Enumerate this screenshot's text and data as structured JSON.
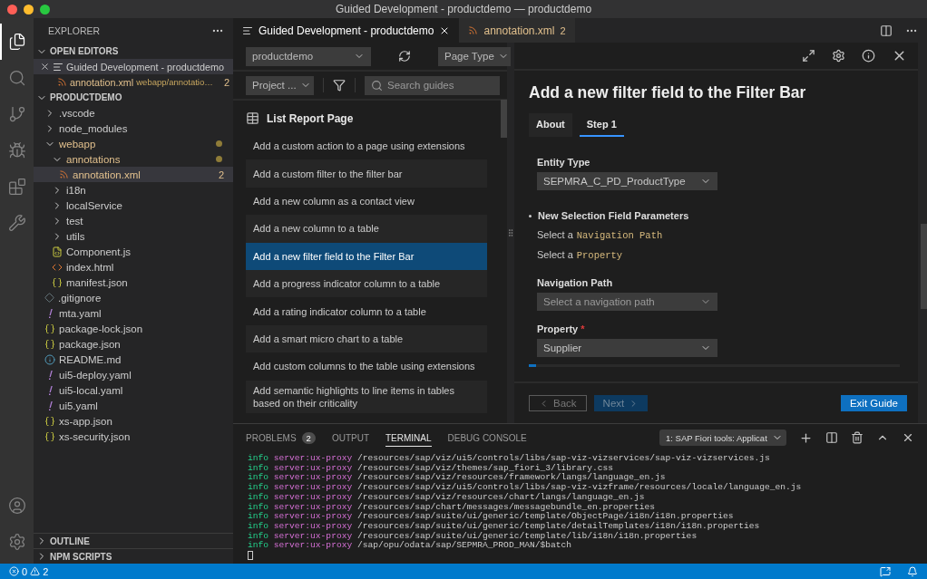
{
  "window": {
    "title": "Guided Development - productdemo — productdemo"
  },
  "activity_bar": {
    "items": [
      {
        "kind": "explorer",
        "selected": true
      },
      {
        "kind": "search",
        "selected": false
      },
      {
        "kind": "source-control",
        "selected": false
      },
      {
        "kind": "run",
        "selected": false
      },
      {
        "kind": "extensions",
        "selected": false
      },
      {
        "kind": "tools",
        "selected": false
      }
    ],
    "bottom": [
      {
        "kind": "account"
      },
      {
        "kind": "settings"
      }
    ]
  },
  "explorer": {
    "title": "EXPLORER",
    "open_editors": {
      "title": "OPEN EDITORS",
      "expanded": true,
      "items": [
        {
          "kind": "guide",
          "name": "Guided Development - productdemo",
          "selected": true
        },
        {
          "kind": "xml",
          "name": "annotation.xml",
          "description": "webapp/annotatio…",
          "badge": "2",
          "modified": true,
          "selected": false
        }
      ]
    },
    "project": {
      "title": "PRODUCTDEMO",
      "expanded": true,
      "children": [
        {
          "kind": "folder",
          "name": ".vscode",
          "expanded": false,
          "modified": false,
          "selected": false
        },
        {
          "kind": "folder",
          "name": "node_modules",
          "expanded": false,
          "modified": false,
          "selected": false
        },
        {
          "kind": "folder",
          "name": "webapp",
          "expanded": true,
          "modified": true,
          "selected": false,
          "children": [
            {
              "kind": "folder",
              "name": "annotations",
              "expanded": true,
              "modified": true,
              "selected": false,
              "children": [
                {
                  "kind": "xml",
                  "name": "annotation.xml",
                  "badge": "2",
                  "modified": true,
                  "selected": true
                }
              ]
            },
            {
              "kind": "folder",
              "name": "i18n",
              "expanded": false,
              "modified": false,
              "selected": false
            },
            {
              "kind": "folder",
              "name": "localService",
              "expanded": false,
              "modified": false,
              "selected": false
            },
            {
              "kind": "folder",
              "name": "test",
              "expanded": false,
              "modified": false,
              "selected": false
            },
            {
              "kind": "folder",
              "name": "utils",
              "expanded": false,
              "modified": false,
              "selected": false
            },
            {
              "kind": "js",
              "name": "Component.js",
              "modified": false,
              "selected": false
            },
            {
              "kind": "html",
              "name": "index.html",
              "modified": false,
              "selected": false
            },
            {
              "kind": "json",
              "name": "manifest.json",
              "modified": false,
              "selected": false
            }
          ]
        },
        {
          "kind": "git",
          "name": ".gitignore",
          "modified": false,
          "selected": false
        },
        {
          "kind": "yaml",
          "name": "mta.yaml",
          "modified": false,
          "selected": false
        },
        {
          "kind": "json",
          "name": "package-lock.json",
          "modified": false,
          "selected": false
        },
        {
          "kind": "json",
          "name": "package.json",
          "modified": false,
          "selected": false
        },
        {
          "kind": "md",
          "name": "README.md",
          "modified": false,
          "selected": false
        },
        {
          "kind": "yaml",
          "name": "ui5-deploy.yaml",
          "modified": false,
          "selected": false
        },
        {
          "kind": "yaml",
          "name": "ui5-local.yaml",
          "modified": false,
          "selected": false
        },
        {
          "kind": "yaml",
          "name": "ui5.yaml",
          "modified": false,
          "selected": false
        },
        {
          "kind": "json",
          "name": "xs-app.json",
          "modified": false,
          "selected": false
        },
        {
          "kind": "json",
          "name": "xs-security.json",
          "modified": false,
          "selected": false
        }
      ]
    },
    "sections": [
      {
        "title": "OUTLINE",
        "expanded": false
      },
      {
        "title": "NPM SCRIPTS",
        "expanded": false
      }
    ]
  },
  "editor_tabs": [
    {
      "kind": "guide",
      "label": "Guided Development - productdemo",
      "selected": true
    },
    {
      "kind": "xml",
      "label": "annotation.xml",
      "badge": "2",
      "selected": false
    }
  ],
  "guides": {
    "project_select": "productdemo",
    "page_type": "Page Type",
    "project_filter": "Project ...",
    "search": {
      "placeholder": "Search guides"
    },
    "section": "List Report Page",
    "items": [
      {
        "label": "Add a custom action to a page using extensions",
        "selected": false
      },
      {
        "label": "Add a custom filter to the filter bar",
        "selected": false
      },
      {
        "label": "Add a new column as a contact view",
        "selected": false
      },
      {
        "label": "Add a new column to a table",
        "selected": false
      },
      {
        "label": "Add a new filter field to the Filter Bar",
        "selected": true
      },
      {
        "label": "Add a progress indicator column to a table",
        "selected": false
      },
      {
        "label": "Add a rating indicator column to a table",
        "selected": false
      },
      {
        "label": "Add a smart micro chart to a table",
        "selected": false
      },
      {
        "label": "Add custom columns to the table using extensions",
        "selected": false
      },
      {
        "label": "Add semantic highlights to line items in tables based on their criticality",
        "selected": false
      }
    ]
  },
  "guide_detail": {
    "title": "Add a new filter field to the Filter Bar",
    "tabs": [
      {
        "label": "About",
        "selected": false
      },
      {
        "label": "Step 1",
        "selected": true
      }
    ],
    "entity_type": {
      "label": "Entity Type",
      "value": "SEPMRA_C_PD_ProductType"
    },
    "bullet": "New Selection Field Parameters",
    "instructions": [
      {
        "text": "Select a",
        "code": "Navigation Path"
      },
      {
        "text": "Select a",
        "code": "Property"
      }
    ],
    "navigation_path": {
      "label": "Navigation Path",
      "placeholder": "Select a navigation path"
    },
    "property": {
      "label": "Property",
      "required_mark": "*",
      "value": "Supplier"
    },
    "progress": {
      "level": 0.02
    },
    "back": {
      "label": "Back",
      "disabled": true
    },
    "next": {
      "label": "Next",
      "disabled": true
    },
    "exit": {
      "label": "Exit Guide"
    }
  },
  "panel": {
    "tabs": [
      {
        "label": "PROBLEMS",
        "badge": "2",
        "selected": false
      },
      {
        "label": "OUTPUT",
        "selected": false
      },
      {
        "label": "TERMINAL",
        "selected": true
      },
      {
        "label": "DEBUG CONSOLE",
        "selected": false
      }
    ],
    "terminal_select": "1: SAP Fiori tools: Applicat",
    "lines": [
      {
        "tag": "info",
        "source": "server:ux-proxy",
        "path": "/resources/sap/viz/ui5/controls/libs/sap-viz-vizservices/sap-viz-vizservices.js"
      },
      {
        "tag": "info",
        "source": "server:ux-proxy",
        "path": "/resources/sap/viz/themes/sap_fiori_3/library.css"
      },
      {
        "tag": "info",
        "source": "server:ux-proxy",
        "path": "/resources/sap/viz/resources/framework/langs/language_en.js"
      },
      {
        "tag": "info",
        "source": "server:ux-proxy",
        "path": "/resources/sap/viz/ui5/controls/libs/sap-viz-vizframe/resources/locale/language_en.js"
      },
      {
        "tag": "info",
        "source": "server:ux-proxy",
        "path": "/resources/sap/viz/resources/chart/langs/language_en.js"
      },
      {
        "tag": "info",
        "source": "server:ux-proxy",
        "path": "/resources/sap/chart/messages/messagebundle_en.properties"
      },
      {
        "tag": "info",
        "source": "server:ux-proxy",
        "path": "/resources/sap/suite/ui/generic/template/ObjectPage/i18n/i18n.properties"
      },
      {
        "tag": "info",
        "source": "server:ux-proxy",
        "path": "/resources/sap/suite/ui/generic/template/detailTemplates/i18n/i18n.properties"
      },
      {
        "tag": "info",
        "source": "server:ux-proxy",
        "path": "/resources/sap/suite/ui/generic/template/lib/i18n/i18n.properties"
      },
      {
        "tag": "info",
        "source": "server:ux-proxy",
        "path": "/sap/opu/odata/sap/SEPMRA_PROD_MAN/$batch"
      }
    ]
  },
  "status_bar": {
    "errors": "0",
    "warnings": "2"
  }
}
